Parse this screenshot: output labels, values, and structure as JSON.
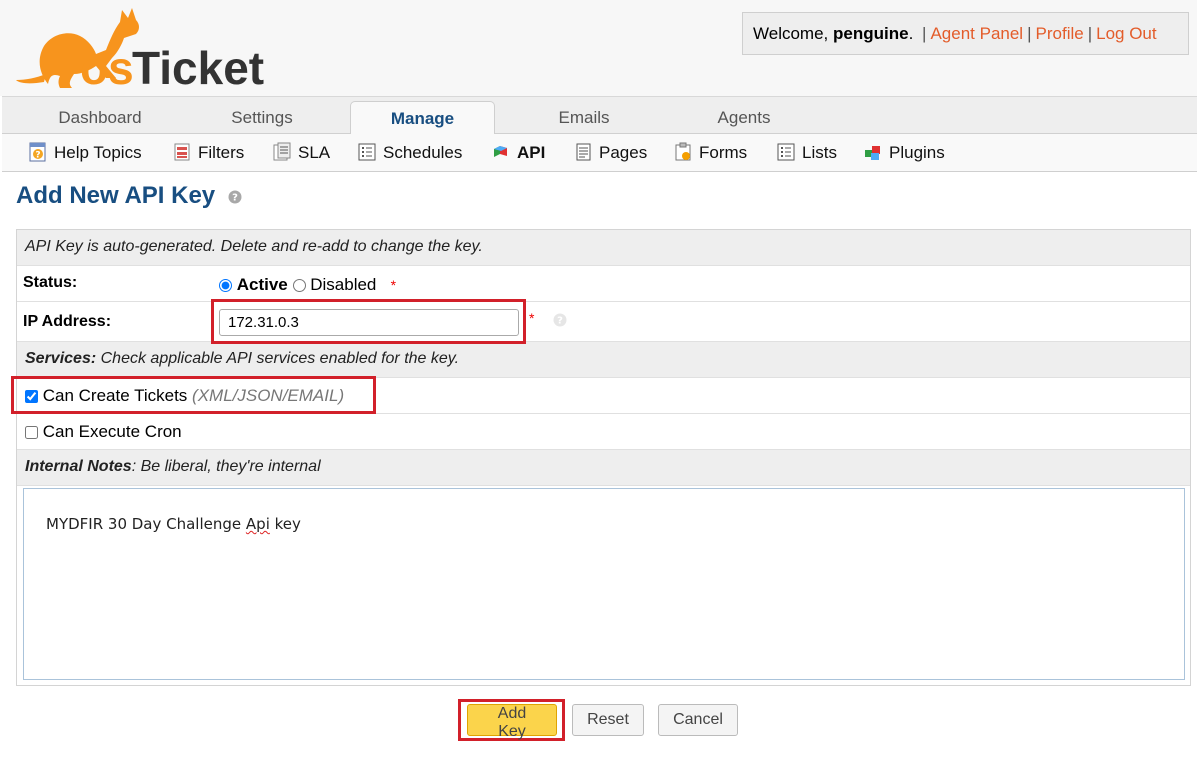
{
  "header": {
    "logo_text": "osTicket",
    "welcome_prefix": "Welcome,",
    "username": "penguine",
    "welcome_suffix": ".",
    "links": [
      "Agent Panel",
      "Profile",
      "Log Out"
    ],
    "separator": "|"
  },
  "tabs": [
    "Dashboard",
    "Settings",
    "Manage",
    "Emails",
    "Agents"
  ],
  "active_tab": "Manage",
  "subnav": [
    {
      "label": "Help Topics",
      "icon": "help-topics-icon"
    },
    {
      "label": "Filters",
      "icon": "filters-icon"
    },
    {
      "label": "SLA",
      "icon": "sla-icon"
    },
    {
      "label": "Schedules",
      "icon": "schedules-icon"
    },
    {
      "label": "API",
      "icon": "api-icon"
    },
    {
      "label": "Pages",
      "icon": "pages-icon"
    },
    {
      "label": "Forms",
      "icon": "forms-icon"
    },
    {
      "label": "Lists",
      "icon": "lists-icon"
    },
    {
      "label": "Plugins",
      "icon": "plugins-icon"
    }
  ],
  "active_subnav": "API",
  "page": {
    "title": "Add New API Key"
  },
  "form": {
    "notice": "API Key is auto-generated. Delete and re-add to change the key.",
    "status_label": "Status:",
    "status_active": "Active",
    "status_disabled": "Disabled",
    "required_mark": "*",
    "ip_label": "IP Address:",
    "ip_value": "172.31.0.3",
    "services_heading": "Services:",
    "services_text": " Check applicable API services enabled for the key.",
    "can_create_tickets": "Can Create Tickets",
    "can_create_tickets_hint": "(XML/JSON/EMAIL)",
    "can_execute_cron": "Can Execute Cron",
    "notes_heading": "Internal Notes",
    "notes_text": ": Be liberal, they're internal",
    "notes_value_pre": "MYDFIR 30 Day Challenge ",
    "notes_value_spell": "Api",
    "notes_value_post": " key"
  },
  "buttons": {
    "add": "Add Key",
    "reset": "Reset",
    "cancel": "Cancel"
  },
  "colors": {
    "brand_orange": "#f7941d",
    "link": "#e35c2a",
    "title_blue": "#184e81",
    "highlight_red": "#d2202a"
  }
}
